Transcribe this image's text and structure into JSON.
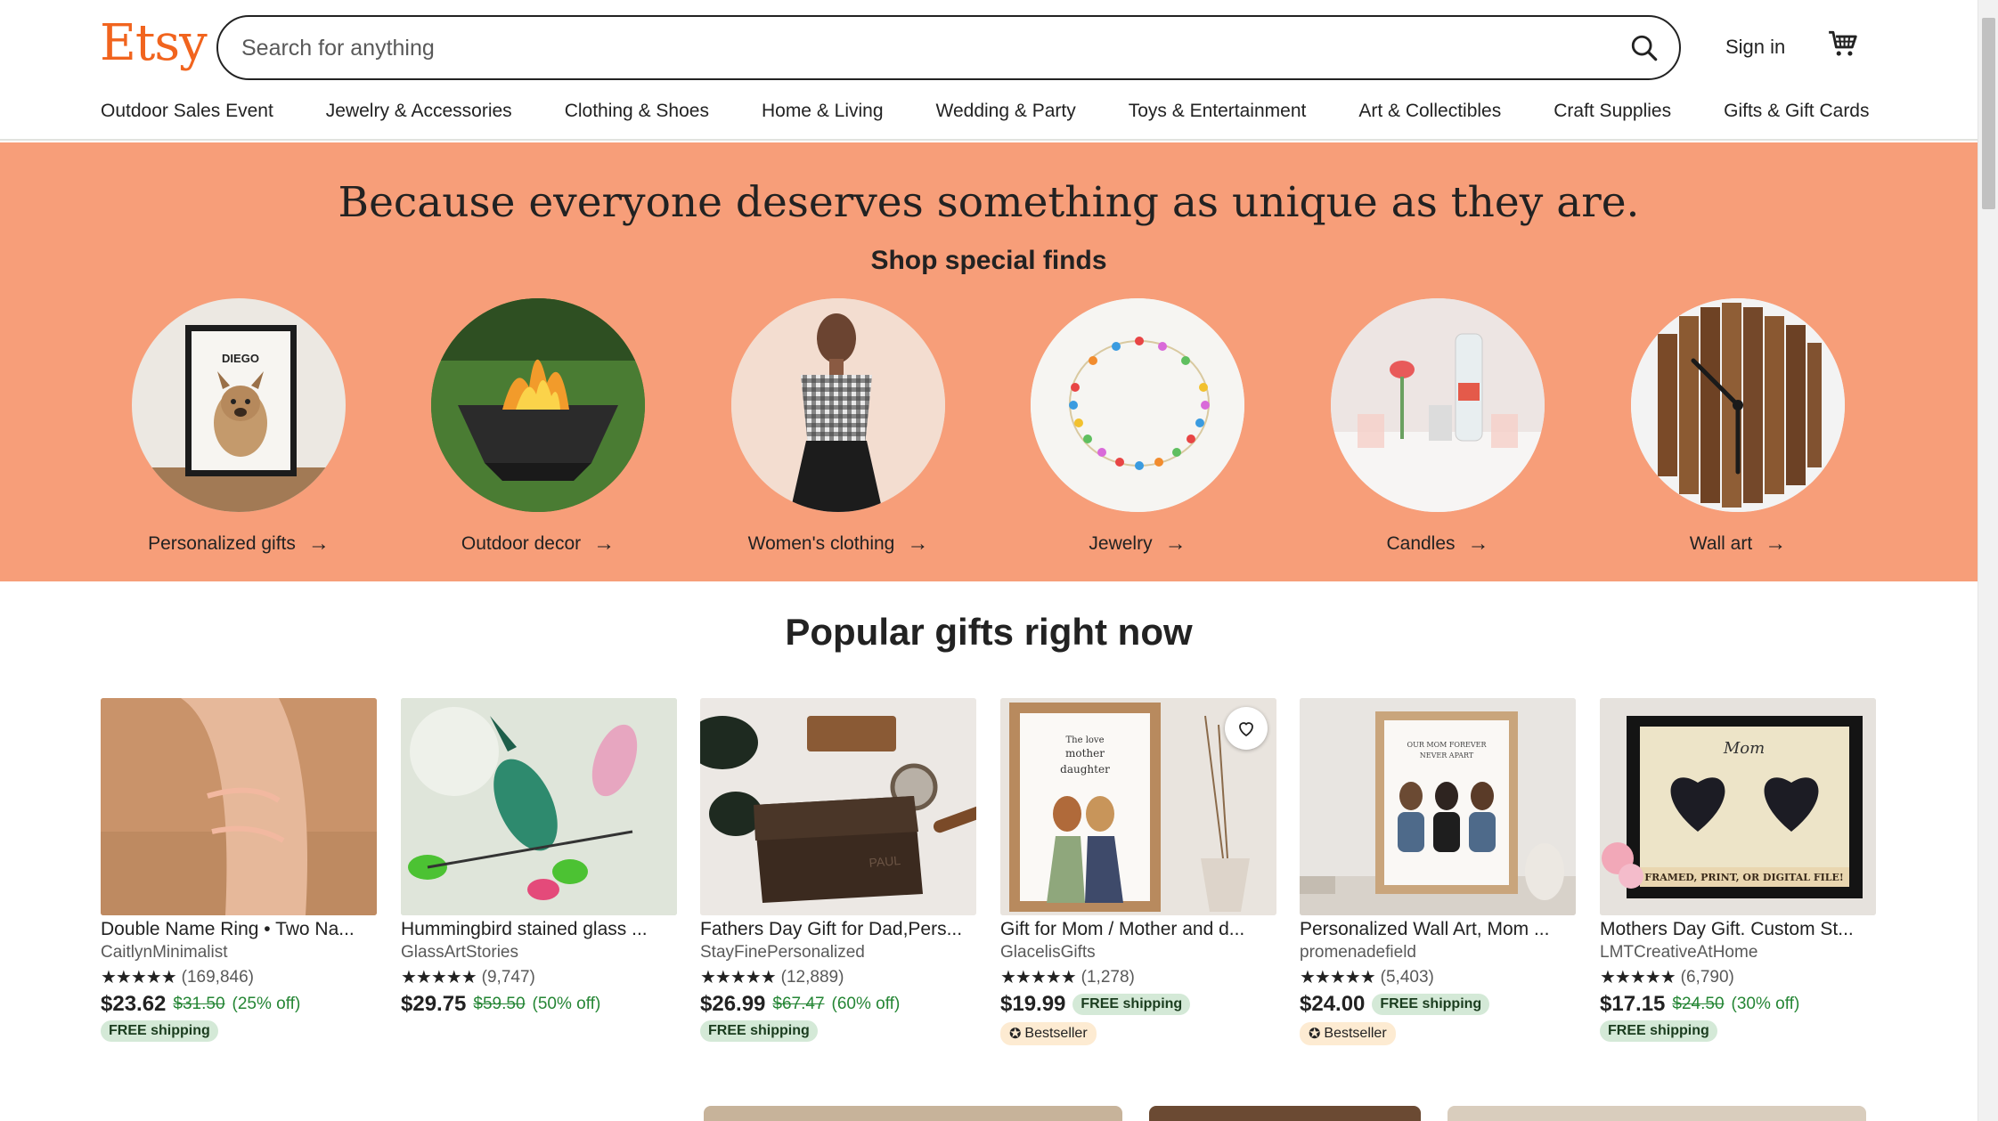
{
  "header": {
    "logo": "Etsy",
    "search_placeholder": "Search for anything",
    "signin_label": "Sign in"
  },
  "nav": [
    "Outdoor Sales Event",
    "Jewelry & Accessories",
    "Clothing & Shoes",
    "Home & Living",
    "Wedding & Party",
    "Toys & Entertainment",
    "Art & Collectibles",
    "Craft Supplies",
    "Gifts & Gift Cards"
  ],
  "banner": {
    "headline": "Because everyone deserves something as unique as they are.",
    "subtitle": "Shop special finds",
    "finds": [
      {
        "label": "Personalized gifts",
        "poster_text": "DIEGO"
      },
      {
        "label": "Outdoor decor"
      },
      {
        "label": "Women's clothing"
      },
      {
        "label": "Jewelry"
      },
      {
        "label": "Candles"
      },
      {
        "label": "Wall art"
      }
    ]
  },
  "popular": {
    "title": "Popular gifts right now",
    "items": [
      {
        "title": "Double Name Ring • Two Na...",
        "shop": "CaitlynMinimalist",
        "reviews": "(169,846)",
        "price": "$23.62",
        "original": "$31.50",
        "discount": "(25% off)",
        "free_shipping": "FREE shipping",
        "bestseller": ""
      },
      {
        "title": "Hummingbird stained glass ...",
        "shop": "GlassArtStories",
        "reviews": "(9,747)",
        "price": "$29.75",
        "original": "$59.50",
        "discount": "(50% off)",
        "free_shipping": "",
        "bestseller": ""
      },
      {
        "title": "Fathers Day Gift for Dad,Pers...",
        "shop": "StayFinePersonalized",
        "reviews": "(12,889)",
        "price": "$26.99",
        "original": "$67.47",
        "discount": "(60% off)",
        "free_shipping": "FREE shipping",
        "bestseller": ""
      },
      {
        "title": "Gift for Mom / Mother and d...",
        "shop": "GlacelisGifts",
        "reviews": "(1,278)",
        "price": "$19.99",
        "original": "",
        "discount": "",
        "free_shipping": "FREE shipping",
        "bestseller": "Bestseller"
      },
      {
        "title": "Personalized Wall Art, Mom ...",
        "shop": "promenadefield",
        "reviews": "(5,403)",
        "price": "$24.00",
        "original": "",
        "discount": "",
        "free_shipping": "FREE shipping",
        "bestseller": "Bestseller"
      },
      {
        "title": "Mothers Day Gift. Custom St...",
        "shop": "LMTCreativeAtHome",
        "reviews": "(6,790)",
        "price": "$17.15",
        "original": "$24.50",
        "discount": "(30% off)",
        "free_shipping": "FREE shipping",
        "bestseller": ""
      }
    ],
    "stars": "★★★★★"
  },
  "colors": {
    "brand": "#f1641e",
    "banner_bg": "#f79e79",
    "discount_green": "#258635",
    "badge_green": "#d4e9d7",
    "bestseller_bg": "#fdebd2"
  }
}
